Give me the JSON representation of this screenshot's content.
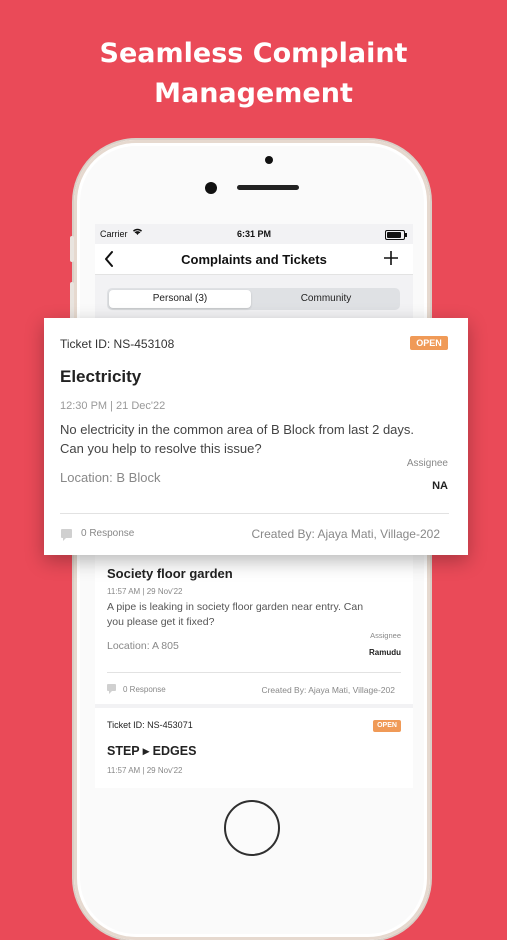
{
  "headline": {
    "line1": "Seamless Complaint",
    "line2": "Management"
  },
  "status_bar": {
    "carrier": "Carrier",
    "time": "6:31 PM",
    "battery_level": 0.9
  },
  "nav": {
    "title": "Complaints and Tickets",
    "back_icon": "chevron-left-icon",
    "add_icon": "plus-icon"
  },
  "segments": {
    "personal": "Personal (3)",
    "community": "Community",
    "selected": "personal"
  },
  "featured_ticket": {
    "ticket_id": "Ticket ID: NS-453108",
    "status": "OPEN",
    "title": "Electricity",
    "timestamp": "12:30 PM | 21 Dec'22",
    "description_line1": "No electricity in the common area of B Block from last 2 days.",
    "description_line2": "Can you help to resolve this issue?",
    "assignee_label": "Assignee",
    "location": "Location: B Block",
    "assignee": "NA",
    "responses": "0 Response",
    "created_by": "Created By: Ajaya Mati, Village-202"
  },
  "tickets": [
    {
      "title": "Society floor garden",
      "timestamp": "11:57 AM | 29 Nov'22",
      "description_line1": "A pipe is leaking in society floor garden near entry. Can",
      "description_line2": "you please get it fixed?",
      "assignee_label": "Assignee",
      "location": "Location:  A 805",
      "assignee": "Ramudu",
      "responses": "0 Response",
      "created_by": "Created By: Ajaya Mati, Village-202"
    },
    {
      "ticket_id": "Ticket ID: NS-453071",
      "status": "OPEN",
      "title": "STEP ▸ EDGES",
      "timestamp": "11:57 AM | 29 Nov'22"
    }
  ],
  "colors": {
    "background": "#ea4a58",
    "status_open": "#f09a57"
  }
}
